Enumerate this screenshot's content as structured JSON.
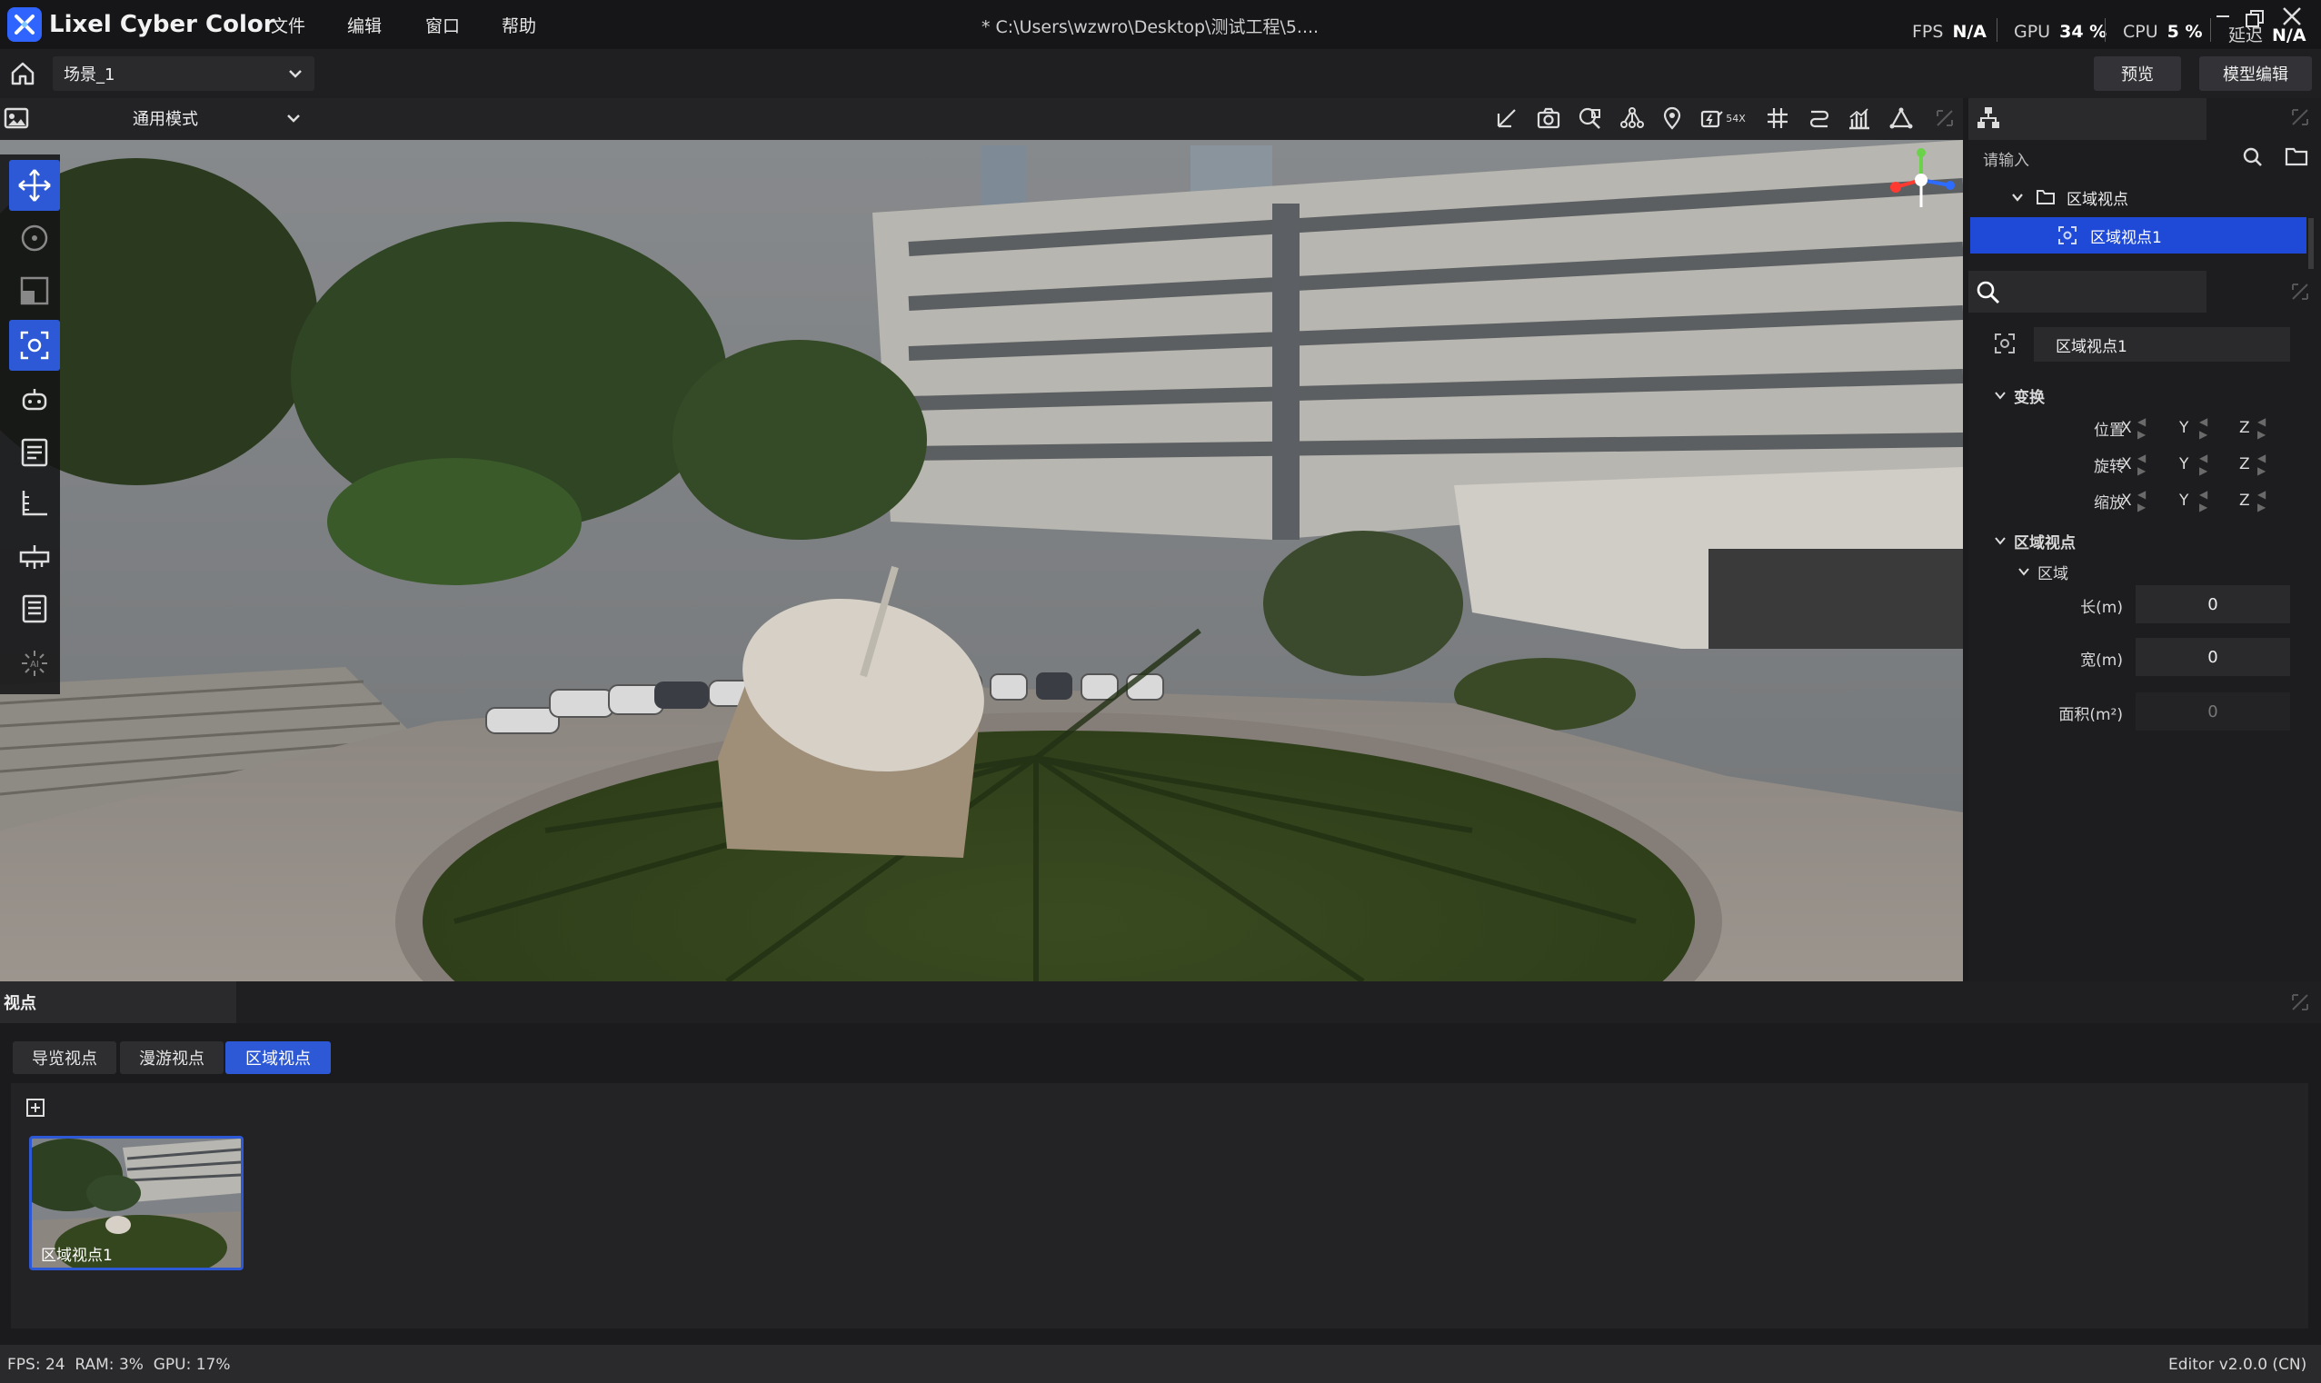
{
  "app": {
    "name": "Lixel Cyber Color"
  },
  "menu": [
    "文件",
    "编辑",
    "窗口",
    "帮助"
  ],
  "file_path": "* C:\\Users\\wzwro\\Desktop\\测试工程\\5....",
  "perf": {
    "fps_label": "FPS",
    "fps_value": "N/A",
    "gpu_label": "GPU",
    "gpu_value": "34 %",
    "cpu_label": "CPU",
    "cpu_value": "5 %",
    "latency_label": "延迟",
    "latency_value": "N/A"
  },
  "toolbar2": {
    "scene": "场景_1",
    "preview_label": "预览",
    "model_edit_label": "模型编辑"
  },
  "viewport": {
    "mode": "通用模式",
    "speed_badge": "54X"
  },
  "tree": {
    "search_placeholder": "请输入",
    "folder_label": "区域视点",
    "selected_item": "区域视点1"
  },
  "inspector": {
    "name_value": "区域视点1",
    "transform_section": "变换",
    "rows": [
      {
        "label": "位置"
      },
      {
        "label": "旋转"
      },
      {
        "label": "缩放"
      }
    ],
    "axes": [
      "X",
      "Y",
      "Z"
    ],
    "region_view_section": "区域视点",
    "region_section": "区域",
    "length_label": "长(m)",
    "length_value": "0",
    "width_label": "宽(m)",
    "width_value": "0",
    "area_label": "面积(m²)",
    "area_value": "0"
  },
  "bottom": {
    "panel_title": "视点",
    "tabs": [
      "导览视点",
      "漫游视点",
      "区域视点"
    ],
    "active_tab": "区域视点",
    "thumbnail_label": "区域视点1"
  },
  "status": {
    "left": "FPS: 24  RAM: 3%  GPU: 17%",
    "right": "Editor v2.0.0 (CN)"
  },
  "colors": {
    "accent": "#2d58d6",
    "selected": "#1f4ad8",
    "panel_bg": "#1d1d1f"
  }
}
